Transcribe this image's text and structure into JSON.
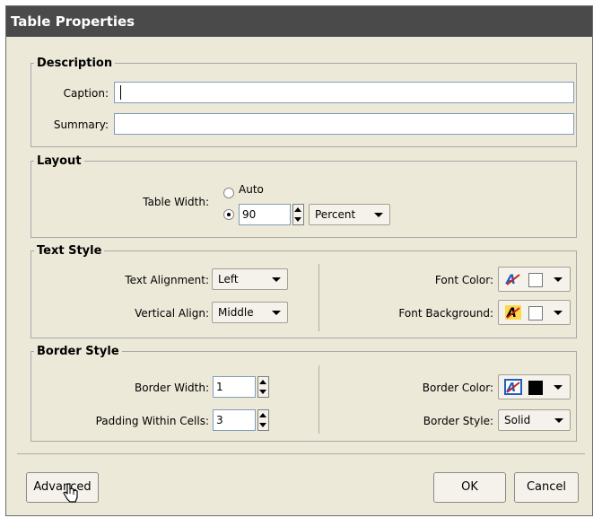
{
  "dialog": {
    "title": "Table Properties"
  },
  "description": {
    "legend": "Description",
    "caption_label": "Caption:",
    "caption_value": "",
    "summary_label": "Summary:",
    "summary_value": ""
  },
  "layout": {
    "legend": "Layout",
    "table_width_label": "Table Width:",
    "auto_label": "Auto",
    "width_value": "90",
    "unit_value": "Percent",
    "selected_radio": "custom"
  },
  "text_style": {
    "legend": "Text Style",
    "text_alignment_label": "Text Alignment:",
    "text_alignment_value": "Left",
    "vertical_align_label": "Vertical Align:",
    "vertical_align_value": "Middle",
    "font_color_label": "Font Color:",
    "font_background_label": "Font Background:"
  },
  "border_style": {
    "legend": "Border Style",
    "border_width_label": "Border Width:",
    "border_width_value": "1",
    "padding_label": "Padding Within Cells:",
    "padding_value": "3",
    "border_color_label": "Border Color:",
    "border_style_label": "Border Style:",
    "border_style_value": "Solid"
  },
  "footer": {
    "advanced_label": "Advanced",
    "ok_label": "OK",
    "cancel_label": "Cancel"
  },
  "icons": [
    "font-color-icon",
    "font-background-icon",
    "border-color-icon",
    "hand-cursor-icon"
  ],
  "colors": {
    "titlebar": "#4a4a4a",
    "dialog_bg": "#ece9d8",
    "icon_blue": "#1f5fbf",
    "icon_red": "#cc1f1f",
    "highlight_yellow": "#ffd84a"
  }
}
